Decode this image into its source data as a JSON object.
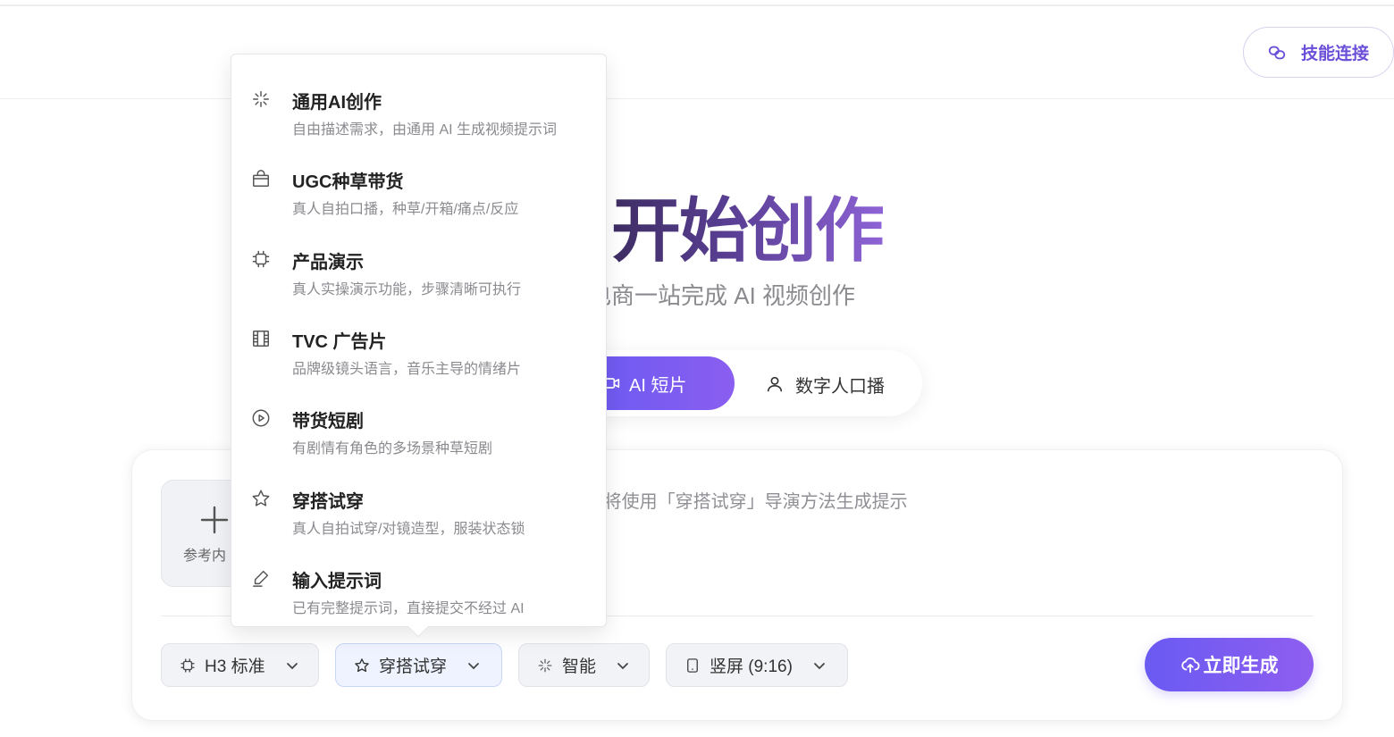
{
  "header": {
    "skill_button_label": "技能连接"
  },
  "hero": {
    "title": "开始创作",
    "subtitle": "电商一站完成 AI 视频创作"
  },
  "mode_tabs": [
    {
      "label": "AI 短片",
      "active": true
    },
    {
      "label": "数字人口播",
      "active": false
    }
  ],
  "composer": {
    "reference_label": "参考内",
    "prompt_text": "要求，并说明语言与视频时长（5-30 秒），将使用「穿搭试穿」导演方法生成提示\n上方选择固定时长。",
    "chips": [
      {
        "label": "H3 标准",
        "icon": "chip-icon"
      },
      {
        "label": "穿搭试穿",
        "icon": "star-icon",
        "selected": true
      },
      {
        "label": "智能",
        "icon": "sparkle-icon"
      },
      {
        "label": "竖屏 (9:16)",
        "icon": "phone-icon"
      }
    ],
    "generate_label": "立即生成"
  },
  "dropdown": {
    "items": [
      {
        "title": "通用AI创作",
        "desc": "自由描述需求，由通用 AI 生成视频提示词",
        "icon": "sparkle-icon"
      },
      {
        "title": "UGC种草带货",
        "desc": "真人自拍口播，种草/开箱/痛点/反应",
        "icon": "shopping-bag-icon"
      },
      {
        "title": "产品演示",
        "desc": "真人实操演示功能，步骤清晰可执行",
        "icon": "chip-icon"
      },
      {
        "title": "TVC 广告片",
        "desc": "品牌级镜头语言，音乐主导的情绪片",
        "icon": "film-icon"
      },
      {
        "title": "带货短剧",
        "desc": "有剧情有角色的多场景种草短剧",
        "icon": "play-circle-icon"
      },
      {
        "title": "穿搭试穿",
        "desc": "真人自拍试穿/对镜造型，服装状态锁",
        "icon": "star-icon"
      },
      {
        "title": "输入提示词",
        "desc": "已有完整提示词，直接提交不经过 AI",
        "icon": "pen-icon"
      }
    ]
  },
  "colors": {
    "accent": "#6a5af2",
    "accent_end": "#8e5ef0",
    "title_gradient_start": "#3e2d63",
    "title_gradient_end": "#8e63d6"
  }
}
